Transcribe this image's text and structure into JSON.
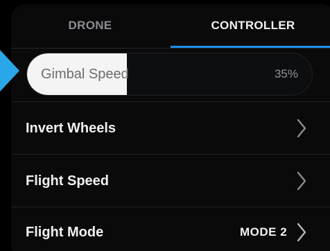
{
  "tabs": {
    "drone": "DRONE",
    "controller": "CONTROLLER",
    "active": "controller"
  },
  "gimbal_speed": {
    "label": "Gimbal Speed",
    "value_text": "35%",
    "fill_fraction": 0.35
  },
  "rows": [
    {
      "label": "Invert Wheels",
      "icon": "chevron-right-icon"
    },
    {
      "label": "Flight Speed",
      "icon": "chevron-right-icon"
    },
    {
      "label": "Flight Mode",
      "value": "MODE 2",
      "icon": "chevron-right-icon"
    }
  ],
  "colors": {
    "accent": "#1f8fe6",
    "pointer": "#2aa7e8",
    "background": "#0a0a0b",
    "text_primary": "#f0f0f0",
    "text_inactive": "#8a8d92",
    "slider_fill": "#f4f4f4"
  }
}
